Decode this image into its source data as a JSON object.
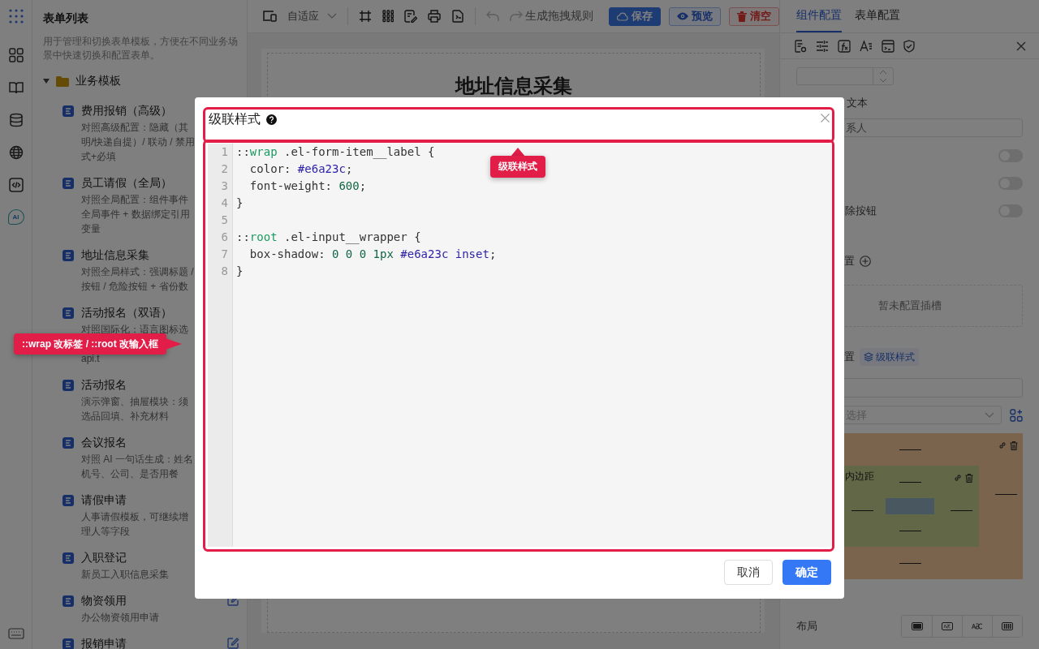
{
  "rail": {
    "ai_label": "AI"
  },
  "sidebar": {
    "title": "表单列表",
    "description": "用于管理和切换表单模板，方便在不同业务场景中快速切换和配置表单。",
    "folder": {
      "label": "业务模板",
      "expanded": true,
      "items": [
        {
          "title": "费用报销（高级）",
          "editable": false,
          "lines": [
            {
              "kind": "text",
              "text": "对照高级配置：隐藏（其"
            },
            {
              "kind": "text",
              "text": "明/快递自提）/ 联动 / 禁用"
            },
            {
              "kind": "text",
              "text": "式+必填"
            }
          ]
        },
        {
          "title": "员工请假（全局）",
          "editable": false,
          "lines": [
            {
              "kind": "text",
              "text": "对照全局配置：组件事件"
            },
            {
              "kind": "text",
              "text": "全局事件 + 数据绑定引用"
            },
            {
              "kind": "text",
              "text": "变量"
            }
          ]
        },
        {
          "title": "地址信息采集",
          "editable": false,
          "lines": [
            {
              "kind": "text",
              "text": "对照全局样式：强调标题 /"
            },
            {
              "kind": "text",
              "text": "按钮 / 危险按钮 + 省份数"
            }
          ]
        },
        {
          "title": "活动报名（双语）",
          "editable": false,
          "lines": [
            {
              "kind": "text",
              "text": "对照国际化：语言图标选"
            },
            {
              "kind": "callout",
              "text": "::wrap 改标签 / ::root 改输入框"
            },
            {
              "kind": "text",
              "text": "api.t"
            }
          ]
        },
        {
          "title": "活动报名",
          "editable": false,
          "lines": [
            {
              "kind": "text",
              "text": "演示弹窗、抽屉模块：须"
            },
            {
              "kind": "text",
              "text": "选品回填、补充材料"
            }
          ]
        },
        {
          "title": "会议报名",
          "editable": false,
          "lines": [
            {
              "kind": "text",
              "text": "对照 AI 一句话生成：姓名"
            },
            {
              "kind": "text",
              "text": "机号、公司、是否用餐"
            }
          ]
        },
        {
          "title": "请假申请",
          "editable": false,
          "lines": [
            {
              "kind": "text",
              "text": "人事请假模板，可继续增"
            },
            {
              "kind": "text",
              "text": "理人等字段"
            }
          ]
        },
        {
          "title": "入职登记",
          "editable": false,
          "lines": [
            {
              "kind": "text",
              "text": "新员工入职信息采集"
            }
          ]
        },
        {
          "title": "物资领用",
          "editable": true,
          "lines": [
            {
              "kind": "text",
              "text": "办公物资领用申请"
            }
          ]
        },
        {
          "title": "报销申请",
          "editable": true
        }
      ]
    }
  },
  "toolbar": {
    "device_select": "自适应",
    "generate_rule": "生成拖拽规则",
    "buttons": [
      {
        "label": "保存",
        "kind": "primary"
      },
      {
        "label": "预览",
        "kind": "info"
      },
      {
        "label": "清空",
        "kind": "danger"
      }
    ]
  },
  "canvas": {
    "title": "地址信息采集"
  },
  "right_panel": {
    "tabs": [
      {
        "label": "组件配置",
        "selected": true
      },
      {
        "label": "表单配置",
        "selected": false
      }
    ],
    "rows": [
      {
        "kind": "number"
      },
      {
        "kind": "label",
        "text": "文本"
      },
      {
        "kind": "input",
        "value": "系人"
      },
      {
        "kind": "switch",
        "on": false
      },
      {
        "kind": "switch",
        "on": false
      },
      {
        "kind": "switch",
        "label": "除按钮",
        "on": false
      },
      {
        "kind": "heading_add",
        "text": "置"
      },
      {
        "kind": "empty",
        "text": "暂未配置插槽"
      },
      {
        "kind": "heading_tag",
        "text": "置",
        "tag": "级联样式"
      },
      {
        "kind": "input"
      },
      {
        "kind": "select",
        "placeholder": "选择"
      },
      {
        "kind": "box_model",
        "inner_label": "内边距"
      },
      {
        "kind": "segmented",
        "label": "布局"
      }
    ]
  },
  "dialog": {
    "title": "级联样式",
    "header_highlight": true,
    "body_highlight": true,
    "callout": "级联样式",
    "code_lines": [
      {
        "number": "1",
        "tokens": [
          {
            "text": "::",
            "kind": "plain"
          },
          {
            "text": "wrap",
            "kind": "pseudo"
          },
          {
            "text": " .el-form-item__label {",
            "kind": "plain"
          }
        ]
      },
      {
        "number": "2",
        "tokens": [
          {
            "text": "  color: ",
            "kind": "plain"
          },
          {
            "text": "#e6a23c",
            "kind": "value"
          },
          {
            "text": ";",
            "kind": "plain"
          }
        ]
      },
      {
        "number": "3",
        "tokens": [
          {
            "text": "  font-weight: ",
            "kind": "plain"
          },
          {
            "text": "600",
            "kind": "number"
          },
          {
            "text": ";",
            "kind": "plain"
          }
        ]
      },
      {
        "number": "4",
        "tokens": [
          {
            "text": "}",
            "kind": "plain"
          }
        ]
      },
      {
        "number": "5"
      },
      {
        "number": "6",
        "tokens": [
          {
            "text": "::",
            "kind": "plain"
          },
          {
            "text": "root",
            "kind": "pseudo"
          },
          {
            "text": " .el-input__wrapper {",
            "kind": "plain"
          }
        ]
      },
      {
        "number": "7",
        "tokens": [
          {
            "text": "  box-shadow: ",
            "kind": "plain"
          },
          {
            "text": "0 0 0 1px",
            "kind": "number"
          },
          {
            "text": " #e6a23c inset",
            "kind": "value"
          },
          {
            "text": ";",
            "kind": "plain"
          }
        ]
      },
      {
        "number": "8",
        "tokens": [
          {
            "text": "}",
            "kind": "plain"
          }
        ]
      }
    ],
    "buttons": [
      {
        "label": "取消",
        "kind": "default"
      },
      {
        "label": "确定",
        "kind": "primary"
      }
    ]
  }
}
